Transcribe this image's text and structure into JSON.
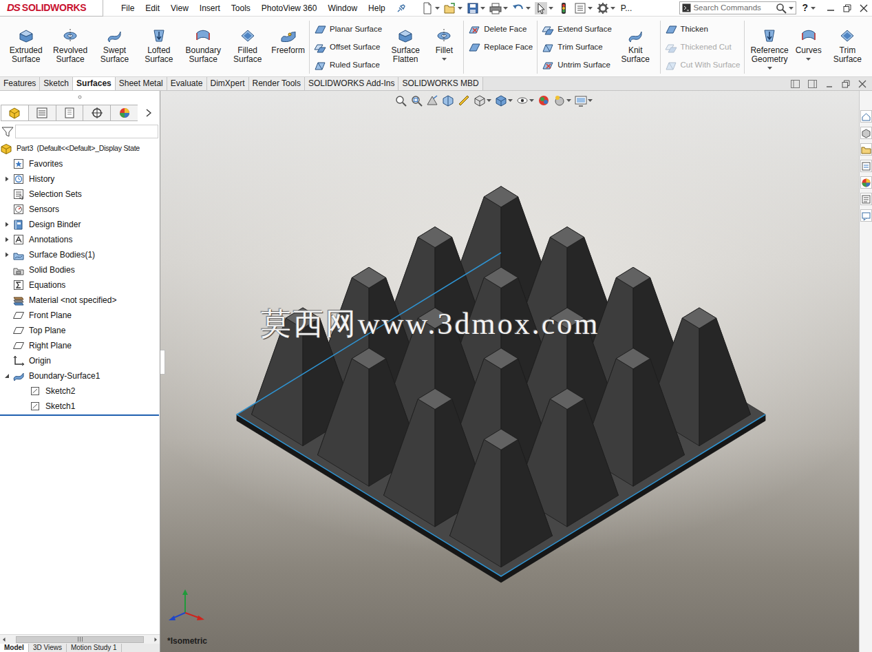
{
  "app": {
    "logo_mark": "DS",
    "logo": "SOLIDWORKS"
  },
  "menu": [
    "File",
    "Edit",
    "View",
    "Insert",
    "Tools",
    "PhotoView 360",
    "Window",
    "Help"
  ],
  "quick_access_overflow": "P...",
  "search": {
    "placeholder": "Search Commands"
  },
  "help": "?",
  "ribbon": {
    "sections": [
      {
        "items": [
          {
            "kind": "large",
            "label": "Extruded Surface",
            "disabled": false,
            "dropdown": false
          },
          {
            "kind": "large",
            "label": "Revolved Surface",
            "disabled": false,
            "dropdown": false
          },
          {
            "kind": "large",
            "label": "Swept Surface",
            "disabled": false,
            "dropdown": false
          },
          {
            "kind": "large",
            "label": "Lofted Surface",
            "disabled": false,
            "dropdown": false
          },
          {
            "kind": "large",
            "label": "Boundary Surface",
            "disabled": false,
            "dropdown": false
          },
          {
            "kind": "large",
            "label": "Filled Surface",
            "disabled": false,
            "dropdown": false
          },
          {
            "kind": "large",
            "label": "Freeform",
            "disabled": false,
            "dropdown": false
          }
        ]
      },
      {
        "items": [
          {
            "kind": "stack",
            "entries": [
              {
                "label": "Planar Surface",
                "disabled": false
              },
              {
                "label": "Offset Surface",
                "disabled": false
              },
              {
                "label": "Ruled Surface",
                "disabled": false
              }
            ]
          },
          {
            "kind": "large",
            "label": "Surface Flatten",
            "disabled": false,
            "dropdown": false
          },
          {
            "kind": "large",
            "label": "Fillet",
            "disabled": false,
            "dropdown": true
          }
        ]
      },
      {
        "items": [
          {
            "kind": "stack",
            "entries": [
              {
                "label": "Delete Face",
                "disabled": false
              },
              {
                "label": "Replace Face",
                "disabled": false
              }
            ]
          }
        ]
      },
      {
        "items": [
          {
            "kind": "stack",
            "entries": [
              {
                "label": "Extend Surface",
                "disabled": false
              },
              {
                "label": "Trim Surface",
                "disabled": false
              },
              {
                "label": "Untrim Surface",
                "disabled": false
              }
            ]
          },
          {
            "kind": "large",
            "label": "Knit Surface",
            "disabled": false,
            "dropdown": false
          }
        ]
      },
      {
        "items": [
          {
            "kind": "stack",
            "entries": [
              {
                "label": "Thicken",
                "disabled": false
              },
              {
                "label": "Thickened Cut",
                "disabled": true
              },
              {
                "label": "Cut With Surface",
                "disabled": true
              }
            ]
          }
        ]
      },
      {
        "items": [
          {
            "kind": "large",
            "label": "Reference Geometry",
            "disabled": false,
            "dropdown": true
          },
          {
            "kind": "large",
            "label": "Curves",
            "disabled": false,
            "dropdown": true
          },
          {
            "kind": "large",
            "label": "Trim Surface",
            "disabled": false,
            "dropdown": false
          }
        ]
      }
    ]
  },
  "tabs": [
    {
      "label": "Features",
      "selected": false
    },
    {
      "label": "Sketch",
      "selected": false
    },
    {
      "label": "Surfaces",
      "selected": true
    },
    {
      "label": "Sheet Metal",
      "selected": false
    },
    {
      "label": "Evaluate",
      "selected": false
    },
    {
      "label": "DimXpert",
      "selected": false
    },
    {
      "label": "Render Tools",
      "selected": false
    },
    {
      "label": "SOLIDWORKS Add-Ins",
      "selected": false
    },
    {
      "label": "SOLIDWORKS MBD",
      "selected": false
    }
  ],
  "feature_manager": {
    "tree": [
      {
        "label": "Part3  (Default<<Default>_Display State",
        "kind": "part",
        "depth": 0,
        "expander": "none"
      },
      {
        "label": "Favorites",
        "kind": "favorites",
        "depth": 1,
        "expander": "none"
      },
      {
        "label": "History",
        "kind": "history",
        "depth": 1,
        "expander": "closed"
      },
      {
        "label": "Selection Sets",
        "kind": "selection",
        "depth": 1,
        "expander": "none"
      },
      {
        "label": "Sensors",
        "kind": "sensors",
        "depth": 1,
        "expander": "none"
      },
      {
        "label": "Design Binder",
        "kind": "binder",
        "depth": 1,
        "expander": "closed"
      },
      {
        "label": "Annotations",
        "kind": "annotations",
        "depth": 1,
        "expander": "closed"
      },
      {
        "label": "Surface Bodies(1)",
        "kind": "surface-bodies",
        "depth": 1,
        "expander": "closed"
      },
      {
        "label": "Solid Bodies",
        "kind": "solid-bodies",
        "depth": 1,
        "expander": "none"
      },
      {
        "label": "Equations",
        "kind": "equations",
        "depth": 1,
        "expander": "none"
      },
      {
        "label": "Material <not specified>",
        "kind": "material",
        "depth": 1,
        "expander": "none"
      },
      {
        "label": "Front Plane",
        "kind": "plane",
        "depth": 1,
        "expander": "none"
      },
      {
        "label": "Top Plane",
        "kind": "plane",
        "depth": 1,
        "expander": "none"
      },
      {
        "label": "Right Plane",
        "kind": "plane",
        "depth": 1,
        "expander": "none"
      },
      {
        "label": "Origin",
        "kind": "origin",
        "depth": 1,
        "expander": "none"
      },
      {
        "label": "Boundary-Surface1",
        "kind": "feature",
        "depth": 1,
        "expander": "open"
      },
      {
        "label": "Sketch2",
        "kind": "sketch",
        "depth": 2,
        "expander": "none"
      },
      {
        "label": "Sketch1",
        "kind": "sketch",
        "depth": 2,
        "expander": "none"
      }
    ]
  },
  "bottom_tabs": [
    {
      "label": "Model",
      "selected": true
    },
    {
      "label": "3D Views",
      "selected": false
    },
    {
      "label": "Motion Study 1",
      "selected": false
    }
  ],
  "viewport": {
    "watermark": "莫西网www.3dmox.com",
    "view_label": "*Isometric"
  }
}
